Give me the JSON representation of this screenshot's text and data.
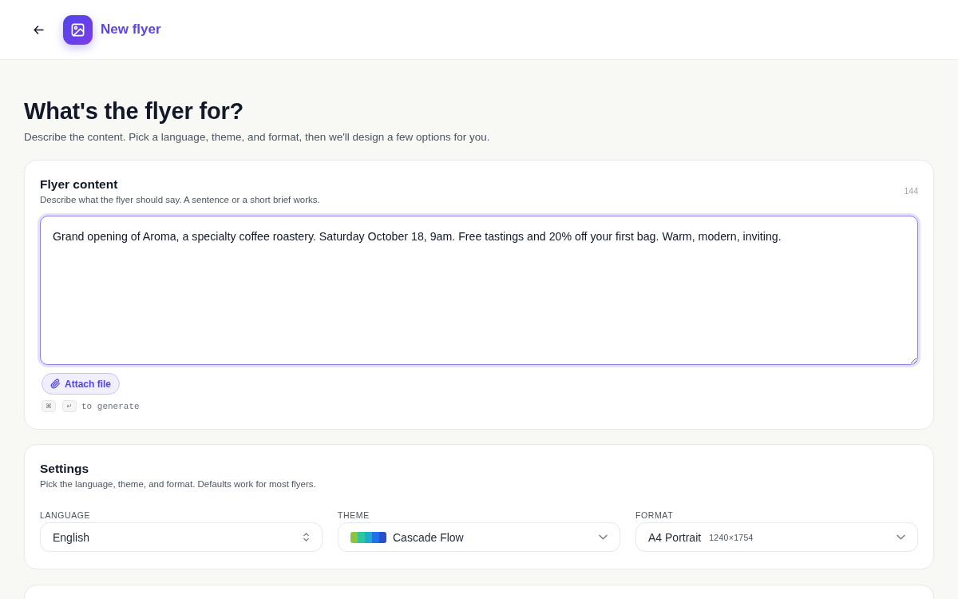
{
  "header": {
    "title": "New flyer"
  },
  "intro": {
    "heading": "What's the flyer for?",
    "subtitle": "Describe the content. Pick a language, theme, and format, then we'll design a few options for you."
  },
  "content_card": {
    "title": "Flyer content",
    "description": "Describe what the flyer should say. A sentence or a short brief works.",
    "count": "144",
    "value": "Grand opening of Aroma, a specialty coffee roastery. Saturday October 18, 9am. Free tastings and 20% off your first bag. Warm, modern, inviting.",
    "focused": true,
    "attach_button": "Attach file",
    "shortcut": {
      "keys": [
        "⌘",
        "↵"
      ],
      "hint": "to generate"
    }
  },
  "settings_card": {
    "title": "Settings",
    "description": "Pick the language, theme, and format. Defaults work for most flyers.",
    "fields": [
      {
        "kind": "stepper",
        "label": "LANGUAGE",
        "value": "English"
      },
      {
        "kind": "dropdown",
        "label": "THEME",
        "value": "Cascade Flow",
        "swatch": [
          {
            "color": "#8cc43f"
          },
          {
            "color": "#2cc79e"
          },
          {
            "color": "#1eaacb"
          },
          {
            "color": "#2270ea"
          },
          {
            "color": "#2a4fcc"
          }
        ]
      },
      {
        "kind": "dropdown",
        "label": "FORMAT",
        "value": "A4 Portrait",
        "detail": "1240×1754"
      }
    ]
  }
}
